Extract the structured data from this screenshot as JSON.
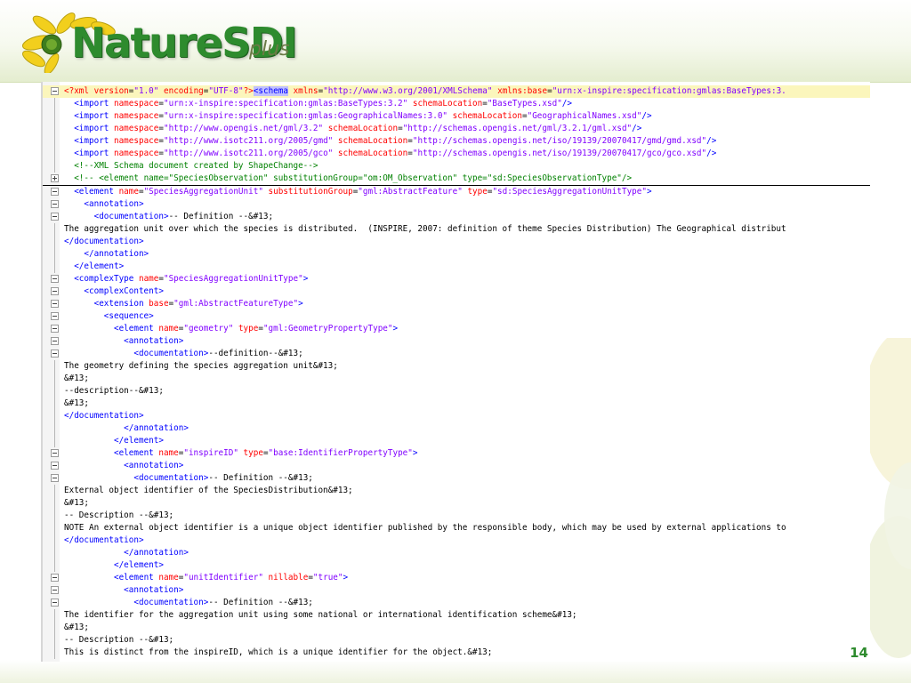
{
  "logo": {
    "name": "NatureSDI",
    "suffix": "plus"
  },
  "slide_number": "14",
  "colors": {
    "brand_green": "#2e8b2e",
    "bracket_blue": "#0000ff",
    "attr_red": "#ff0000",
    "value_purple": "#8000ff",
    "comment_green": "#008000",
    "line_highlight": "#fbf6bc"
  },
  "icons": {
    "fold_open": "minus-box-icon",
    "fold_closed": "plus-box-icon"
  },
  "lines": [
    {
      "fold": "minus",
      "hl": true,
      "t": [
        [
          "pi",
          "<?xml "
        ],
        [
          "at",
          "version"
        ],
        [
          "tx",
          "="
        ],
        [
          "vl",
          "\"1.0\""
        ],
        [
          "tx",
          " "
        ],
        [
          "at",
          "encoding"
        ],
        [
          "tx",
          "="
        ],
        [
          "vl",
          "\"UTF-8\""
        ],
        [
          "pi",
          "?>"
        ],
        [
          "sel",
          "<schema"
        ],
        [
          "tx",
          " "
        ],
        [
          "at",
          "xmlns"
        ],
        [
          "tx",
          "="
        ],
        [
          "vl",
          "\"http://www.w3.org/2001/XMLSchema\""
        ],
        [
          "tx",
          " "
        ],
        [
          "at",
          "xmlns:base"
        ],
        [
          "tx",
          "="
        ],
        [
          "vl",
          "\"urn:x-inspire:specification:gmlas:BaseTypes:3."
        ]
      ]
    },
    {
      "fold": "vline",
      "t": [
        [
          "tx",
          "  "
        ],
        [
          "bk",
          "<import "
        ],
        [
          "at",
          "namespace"
        ],
        [
          "tx",
          "="
        ],
        [
          "vl",
          "\"urn:x-inspire:specification:gmlas:BaseTypes:3.2\""
        ],
        [
          "tx",
          " "
        ],
        [
          "at",
          "schemaLocation"
        ],
        [
          "tx",
          "="
        ],
        [
          "vl",
          "\"BaseTypes.xsd\""
        ],
        [
          "bk",
          "/>"
        ]
      ]
    },
    {
      "fold": "vline",
      "t": [
        [
          "tx",
          "  "
        ],
        [
          "bk",
          "<import "
        ],
        [
          "at",
          "namespace"
        ],
        [
          "tx",
          "="
        ],
        [
          "vl",
          "\"urn:x-inspire:specification:gmlas:GeographicalNames:3.0\""
        ],
        [
          "tx",
          " "
        ],
        [
          "at",
          "schemaLocation"
        ],
        [
          "tx",
          "="
        ],
        [
          "vl",
          "\"GeographicalNames.xsd\""
        ],
        [
          "bk",
          "/>"
        ]
      ]
    },
    {
      "fold": "vline",
      "t": [
        [
          "tx",
          "  "
        ],
        [
          "bk",
          "<import "
        ],
        [
          "at",
          "namespace"
        ],
        [
          "tx",
          "="
        ],
        [
          "vl",
          "\"http://www.opengis.net/gml/3.2\""
        ],
        [
          "tx",
          " "
        ],
        [
          "at",
          "schemaLocation"
        ],
        [
          "tx",
          "="
        ],
        [
          "vl",
          "\"http://schemas.opengis.net/gml/3.2.1/gml.xsd\""
        ],
        [
          "bk",
          "/>"
        ]
      ]
    },
    {
      "fold": "vline",
      "t": [
        [
          "tx",
          "  "
        ],
        [
          "bk",
          "<import "
        ],
        [
          "at",
          "namespace"
        ],
        [
          "tx",
          "="
        ],
        [
          "vl",
          "\"http://www.isotc211.org/2005/gmd\""
        ],
        [
          "tx",
          " "
        ],
        [
          "at",
          "schemaLocation"
        ],
        [
          "tx",
          "="
        ],
        [
          "vl",
          "\"http://schemas.opengis.net/iso/19139/20070417/gmd/gmd.xsd\""
        ],
        [
          "bk",
          "/>"
        ]
      ]
    },
    {
      "fold": "vline",
      "t": [
        [
          "tx",
          "  "
        ],
        [
          "bk",
          "<import "
        ],
        [
          "at",
          "namespace"
        ],
        [
          "tx",
          "="
        ],
        [
          "vl",
          "\"http://www.isotc211.org/2005/gco\""
        ],
        [
          "tx",
          " "
        ],
        [
          "at",
          "schemaLocation"
        ],
        [
          "tx",
          "="
        ],
        [
          "vl",
          "\"http://schemas.opengis.net/iso/19139/20070417/gco/gco.xsd\""
        ],
        [
          "bk",
          "/>"
        ]
      ]
    },
    {
      "fold": "vline",
      "t": [
        [
          "tx",
          "  "
        ],
        [
          "cm",
          "<!--XML Schema document created by ShapeChange-->"
        ]
      ]
    },
    {
      "fold": "plus",
      "sep": true,
      "t": [
        [
          "tx",
          "  "
        ],
        [
          "cm",
          "<!-- <element name=\"SpeciesObservation\" substitutionGroup=\"om:OM_Observation\" type=\"sd:SpeciesObservationType\"/>"
        ]
      ]
    },
    {
      "fold": "minus",
      "t": [
        [
          "tx",
          "  "
        ],
        [
          "bk",
          "<element "
        ],
        [
          "at",
          "name"
        ],
        [
          "tx",
          "="
        ],
        [
          "vl",
          "\"SpeciesAggregationUnit\""
        ],
        [
          "tx",
          " "
        ],
        [
          "at",
          "substitutionGroup"
        ],
        [
          "tx",
          "="
        ],
        [
          "vl",
          "\"gml:AbstractFeature\""
        ],
        [
          "tx",
          " "
        ],
        [
          "at",
          "type"
        ],
        [
          "tx",
          "="
        ],
        [
          "vl",
          "\"sd:SpeciesAggregationUnitType\""
        ],
        [
          "bk",
          ">"
        ]
      ]
    },
    {
      "fold": "minus",
      "t": [
        [
          "tx",
          "    "
        ],
        [
          "bk",
          "<annotation>"
        ]
      ]
    },
    {
      "fold": "minus",
      "t": [
        [
          "tx",
          "      "
        ],
        [
          "bk",
          "<documentation>"
        ],
        [
          "tx",
          "-- Definition --&#13;"
        ]
      ]
    },
    {
      "fold": "vline",
      "t": [
        [
          "tx",
          "The aggregation unit over which the species is distributed.  (INSPIRE, 2007: definition of theme Species Distribution) The Geographical distribut"
        ]
      ]
    },
    {
      "fold": "vline",
      "t": [
        [
          "bk",
          "</documentation>"
        ]
      ]
    },
    {
      "fold": "vline",
      "t": [
        [
          "tx",
          "    "
        ],
        [
          "bk",
          "</annotation>"
        ]
      ]
    },
    {
      "fold": "vline",
      "t": [
        [
          "tx",
          "  "
        ],
        [
          "bk",
          "</element>"
        ]
      ]
    },
    {
      "fold": "minus",
      "t": [
        [
          "tx",
          "  "
        ],
        [
          "bk",
          "<complexType "
        ],
        [
          "at",
          "name"
        ],
        [
          "tx",
          "="
        ],
        [
          "vl",
          "\"SpeciesAggregationUnitType\""
        ],
        [
          "bk",
          ">"
        ]
      ]
    },
    {
      "fold": "minus",
      "t": [
        [
          "tx",
          "    "
        ],
        [
          "bk",
          "<complexContent>"
        ]
      ]
    },
    {
      "fold": "minus",
      "t": [
        [
          "tx",
          "      "
        ],
        [
          "bk",
          "<extension "
        ],
        [
          "at",
          "base"
        ],
        [
          "tx",
          "="
        ],
        [
          "vl",
          "\"gml:AbstractFeatureType\""
        ],
        [
          "bk",
          ">"
        ]
      ]
    },
    {
      "fold": "minus",
      "t": [
        [
          "tx",
          "        "
        ],
        [
          "bk",
          "<sequence>"
        ]
      ]
    },
    {
      "fold": "minus",
      "t": [
        [
          "tx",
          "          "
        ],
        [
          "bk",
          "<element "
        ],
        [
          "at",
          "name"
        ],
        [
          "tx",
          "="
        ],
        [
          "vl",
          "\"geometry\""
        ],
        [
          "tx",
          " "
        ],
        [
          "at",
          "type"
        ],
        [
          "tx",
          "="
        ],
        [
          "vl",
          "\"gml:GeometryPropertyType\""
        ],
        [
          "bk",
          ">"
        ]
      ]
    },
    {
      "fold": "minus",
      "t": [
        [
          "tx",
          "            "
        ],
        [
          "bk",
          "<annotation>"
        ]
      ]
    },
    {
      "fold": "minus",
      "t": [
        [
          "tx",
          "              "
        ],
        [
          "bk",
          "<documentation>"
        ],
        [
          "tx",
          "--definition--&#13;"
        ]
      ]
    },
    {
      "fold": "vline",
      "t": [
        [
          "tx",
          "The geometry defining the species aggregation unit&#13;"
        ]
      ]
    },
    {
      "fold": "vline",
      "t": [
        [
          "tx",
          "&#13;"
        ]
      ]
    },
    {
      "fold": "vline",
      "t": [
        [
          "tx",
          "--description--&#13;"
        ]
      ]
    },
    {
      "fold": "vline",
      "t": [
        [
          "tx",
          "&#13;"
        ]
      ]
    },
    {
      "fold": "vline",
      "t": [
        [
          "bk",
          "</documentation>"
        ]
      ]
    },
    {
      "fold": "vline",
      "t": [
        [
          "tx",
          "            "
        ],
        [
          "bk",
          "</annotation>"
        ]
      ]
    },
    {
      "fold": "vline",
      "t": [
        [
          "tx",
          "          "
        ],
        [
          "bk",
          "</element>"
        ]
      ]
    },
    {
      "fold": "minus",
      "t": [
        [
          "tx",
          "          "
        ],
        [
          "bk",
          "<element "
        ],
        [
          "at",
          "name"
        ],
        [
          "tx",
          "="
        ],
        [
          "vl",
          "\"inspireID\""
        ],
        [
          "tx",
          " "
        ],
        [
          "at",
          "type"
        ],
        [
          "tx",
          "="
        ],
        [
          "vl",
          "\"base:IdentifierPropertyType\""
        ],
        [
          "bk",
          ">"
        ]
      ]
    },
    {
      "fold": "minus",
      "t": [
        [
          "tx",
          "            "
        ],
        [
          "bk",
          "<annotation>"
        ]
      ]
    },
    {
      "fold": "minus",
      "t": [
        [
          "tx",
          "              "
        ],
        [
          "bk",
          "<documentation>"
        ],
        [
          "tx",
          "-- Definition --&#13;"
        ]
      ]
    },
    {
      "fold": "vline",
      "t": [
        [
          "tx",
          "External object identifier of the SpeciesDistribution&#13;"
        ]
      ]
    },
    {
      "fold": "vline",
      "t": [
        [
          "tx",
          "&#13;"
        ]
      ]
    },
    {
      "fold": "vline",
      "t": [
        [
          "tx",
          "-- Description --&#13;"
        ]
      ]
    },
    {
      "fold": "vline",
      "t": [
        [
          "tx",
          "NOTE An external object identifier is a unique object identifier published by the responsible body, which may be used by external applications to"
        ]
      ]
    },
    {
      "fold": "vline",
      "t": [
        [
          "bk",
          "</documentation>"
        ]
      ]
    },
    {
      "fold": "vline",
      "t": [
        [
          "tx",
          "            "
        ],
        [
          "bk",
          "</annotation>"
        ]
      ]
    },
    {
      "fold": "vline",
      "t": [
        [
          "tx",
          "          "
        ],
        [
          "bk",
          "</element>"
        ]
      ]
    },
    {
      "fold": "minus",
      "t": [
        [
          "tx",
          "          "
        ],
        [
          "bk",
          "<element "
        ],
        [
          "at",
          "name"
        ],
        [
          "tx",
          "="
        ],
        [
          "vl",
          "\"unitIdentifier\""
        ],
        [
          "tx",
          " "
        ],
        [
          "at",
          "nillable"
        ],
        [
          "tx",
          "="
        ],
        [
          "vl",
          "\"true\""
        ],
        [
          "bk",
          ">"
        ]
      ]
    },
    {
      "fold": "minus",
      "t": [
        [
          "tx",
          "            "
        ],
        [
          "bk",
          "<annotation>"
        ]
      ]
    },
    {
      "fold": "minus",
      "t": [
        [
          "tx",
          "              "
        ],
        [
          "bk",
          "<documentation>"
        ],
        [
          "tx",
          "-- Definition --&#13;"
        ]
      ]
    },
    {
      "fold": "vline",
      "t": [
        [
          "tx",
          "The identifier for the aggregation unit using some national or international identification scheme&#13;"
        ]
      ]
    },
    {
      "fold": "vline",
      "t": [
        [
          "tx",
          "&#13;"
        ]
      ]
    },
    {
      "fold": "vline",
      "t": [
        [
          "tx",
          "-- Description --&#13;"
        ]
      ]
    },
    {
      "fold": "vline",
      "t": [
        [
          "tx",
          "This is distinct from the inspireID, which is a unique identifier for the object.&#13;"
        ]
      ]
    }
  ]
}
